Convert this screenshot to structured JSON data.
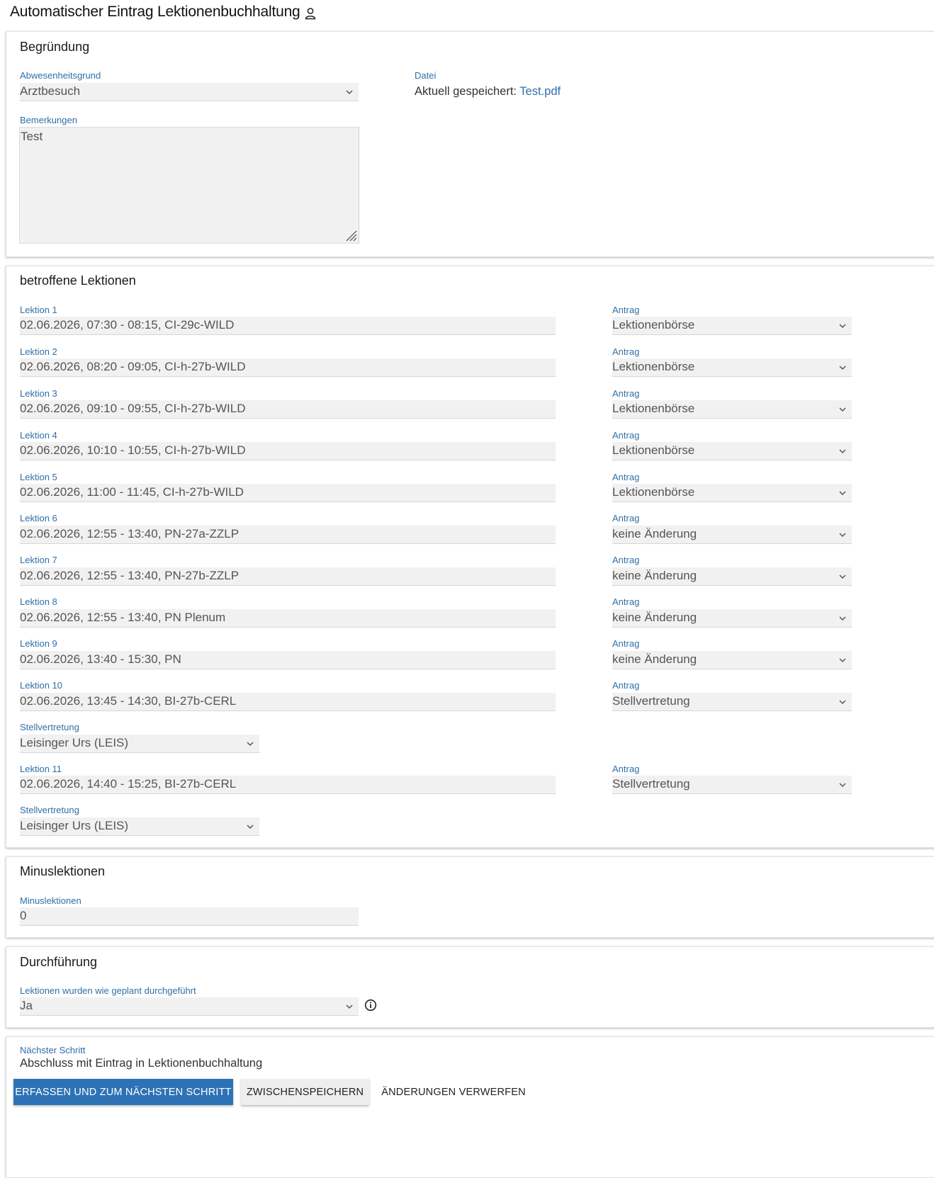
{
  "header": {
    "title": "Automatischer Eintrag Lektionenbuchhaltung",
    "user_icon": "person-icon"
  },
  "begruendung": {
    "title": "Begründung",
    "reason_label": "Abwesenheitsgrund",
    "reason_value": "Arztbesuch",
    "file_label": "Datei",
    "file_prefix": "Aktuell gespeichert:",
    "file_name": "Test.pdf",
    "remarks_label": "Bemerkungen",
    "remarks_value": "Test"
  },
  "lektionen": {
    "title": "betroffene Lektionen",
    "antrag_label": "Antrag",
    "substitute_label": "Stellvertretung",
    "items": [
      {
        "label": "Lektion 1",
        "value": "02.06.2026, 07:30 - 08:15, CI-29c-WILD",
        "antrag": "Lektionenbörse"
      },
      {
        "label": "Lektion 2",
        "value": "02.06.2026, 08:20 - 09:05, CI-h-27b-WILD",
        "antrag": "Lektionenbörse"
      },
      {
        "label": "Lektion 3",
        "value": "02.06.2026, 09:10 - 09:55, CI-h-27b-WILD",
        "antrag": "Lektionenbörse"
      },
      {
        "label": "Lektion 4",
        "value": "02.06.2026, 10:10 - 10:55, CI-h-27b-WILD",
        "antrag": "Lektionenbörse"
      },
      {
        "label": "Lektion 5",
        "value": "02.06.2026, 11:00 - 11:45, CI-h-27b-WILD",
        "antrag": "Lektionenbörse"
      },
      {
        "label": "Lektion 6",
        "value": "02.06.2026, 12:55 - 13:40, PN-27a-ZZLP",
        "antrag": "keine Änderung"
      },
      {
        "label": "Lektion 7",
        "value": "02.06.2026, 12:55 - 13:40, PN-27b-ZZLP",
        "antrag": "keine Änderung"
      },
      {
        "label": "Lektion 8",
        "value": "02.06.2026, 12:55 - 13:40, PN Plenum",
        "antrag": "keine Änderung"
      },
      {
        "label": "Lektion 9",
        "value": "02.06.2026, 13:40 - 15:30, PN",
        "antrag": "keine Änderung"
      },
      {
        "label": "Lektion 10",
        "value": "02.06.2026, 13:45 - 14:30, BI-27b-CERL",
        "antrag": "Stellvertretung",
        "substitute": "Leisinger Urs (LEIS)"
      },
      {
        "label": "Lektion 11",
        "value": "02.06.2026, 14:40 - 15:25, BI-27b-CERL",
        "antrag": "Stellvertretung",
        "substitute": "Leisinger Urs (LEIS)"
      }
    ]
  },
  "minus": {
    "title": "Minuslektionen",
    "label": "Minuslektionen",
    "value": "0"
  },
  "durchfuehrung": {
    "title": "Durchführung",
    "label": "Lektionen wurden wie geplant durchgeführt",
    "value": "Ja"
  },
  "footer": {
    "next_step_label": "Nächster Schritt",
    "next_step_value": "Abschluss mit Eintrag in Lektionenbuchhaltung",
    "submit_label": "ERFASSEN UND ZUM NÄCHSTEN SCHRITT",
    "save_label": "ZWISCHENSPEICHERN",
    "discard_label": "ÄNDERUNGEN VERWERFEN"
  }
}
